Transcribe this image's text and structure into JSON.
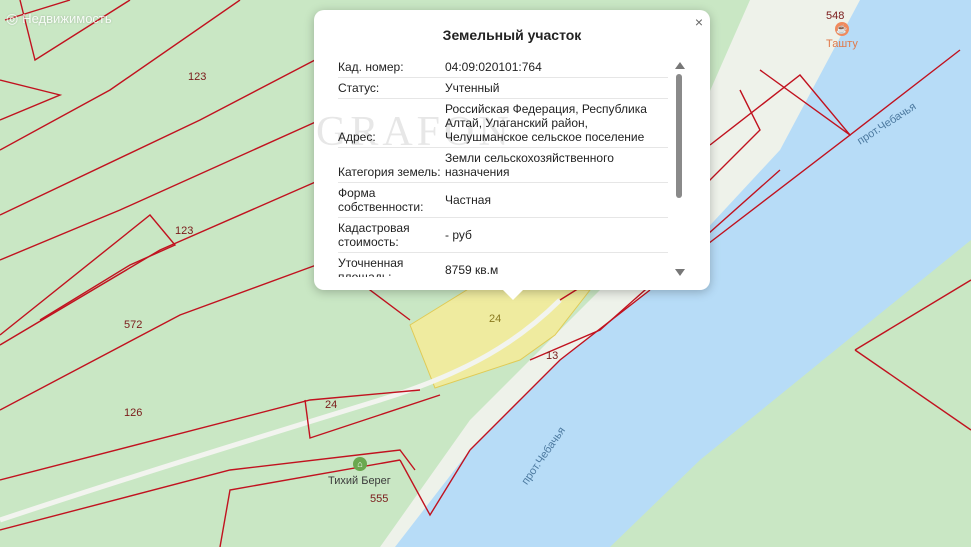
{
  "map": {
    "logo_text": "Недвижимость",
    "river_label_1": "прот.Чебачья",
    "river_label_2": "прот.Чебачья",
    "plot_numbers": [
      "123",
      "123",
      "572",
      "126",
      "24",
      "24",
      "13",
      "548",
      "555"
    ],
    "pois": [
      {
        "name": "Ташту",
        "icon": "cafe-icon",
        "color": "#f08a5d"
      },
      {
        "name": "Тихий Берег",
        "icon": "lodging-icon",
        "color": "#6aa84f"
      }
    ],
    "colors": {
      "land": "#c9e7c4",
      "river": "#b7dcf7",
      "shore": "#eef2ea",
      "boundary": "#c1121f",
      "highlight": "#f4ec9c"
    }
  },
  "popup": {
    "title": "Земельный участок",
    "watermark": "GRAFON",
    "close_symbol": "×",
    "rows": [
      {
        "key": "Кад. номер:",
        "value": "04:09:020101:764"
      },
      {
        "key": "Статус:",
        "value": "Учтенный"
      },
      {
        "key": "Адрес:",
        "value": "Российская Федерация, Республика Алтай, Улаганский район, Челушманское сельское поселение"
      },
      {
        "key": "Категория земель:",
        "value": "Земли сельскохозяйственного назначения"
      },
      {
        "key": "Форма собственности:",
        "value": "Частная"
      },
      {
        "key": "Кадастровая стоимость:",
        "value": "- руб"
      },
      {
        "key": "Уточненная площадь:",
        "value": "8759 кв.м"
      }
    ]
  }
}
